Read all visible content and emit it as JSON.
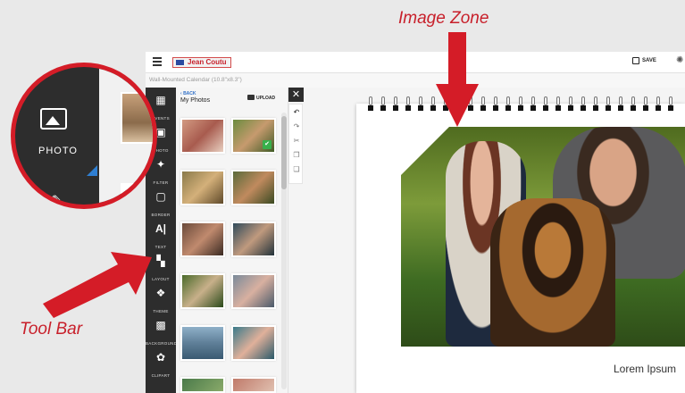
{
  "annotations": {
    "image_zone": "Image Zone",
    "tool_bar": "Tool Bar"
  },
  "header": {
    "logo_text": "Jean Coutu",
    "save_label": "SAVE"
  },
  "subtitle": "Wall-Mounted Calendar (10.8\"x8.3\")",
  "toolbar": {
    "items": [
      {
        "label": "EVENTS",
        "icon": "calendar-icon"
      },
      {
        "label": "PHOTO",
        "icon": "photo-icon"
      },
      {
        "label": "FILTER",
        "icon": "magic-wand-icon"
      },
      {
        "label": "BORDER",
        "icon": "border-icon"
      },
      {
        "label": "TEXT",
        "icon": "text-icon"
      },
      {
        "label": "LAYOUT",
        "icon": "layout-icon"
      },
      {
        "label": "THEME",
        "icon": "palette-icon"
      },
      {
        "label": "BACKGROUND",
        "icon": "background-icon"
      },
      {
        "label": "CLIPART",
        "icon": "clipart-icon"
      }
    ]
  },
  "panel": {
    "back_label": "BACK",
    "title": "My Photos",
    "upload_label": "UPLOAD"
  },
  "canvas": {
    "caption": "Lorem Ipsum"
  },
  "magnifier": {
    "label": "PHOTO"
  },
  "colors": {
    "accent": "#d41c27",
    "toolbar": "#2d2d2d",
    "link": "#2f6fc7",
    "check": "#37b04b"
  }
}
